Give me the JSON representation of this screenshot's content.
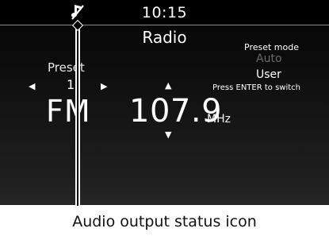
{
  "status_bar": {
    "time": "10:15",
    "audio_icon": "audio-output-status-icon"
  },
  "radio": {
    "title": "Radio",
    "preset_label": "Preset",
    "preset_number": "1",
    "preset_prev_glyph": "◀",
    "preset_next_glyph": "▶",
    "band": "FM",
    "tune_up_glyph": "▲",
    "frequency": "107.9",
    "unit": "MHz",
    "tune_down_glyph": "▼"
  },
  "preset_mode": {
    "title": "Preset mode",
    "options": [
      "Auto",
      "User"
    ],
    "selected": "User",
    "hint": "Press ENTER to switch"
  },
  "callout": {
    "caption": "Audio output status icon"
  },
  "colors": {
    "screen_bg": "#0c0c0c",
    "text": "#ffffff",
    "inactive_option": "#6a6a6a",
    "divider": "#8a8a8a"
  }
}
